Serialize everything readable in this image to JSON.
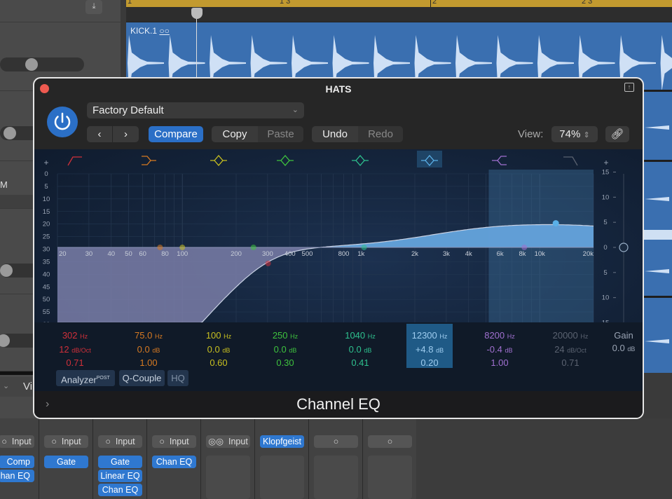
{
  "daw": {
    "ruler_labels": [
      "1",
      "1 3",
      "2",
      "2 3"
    ],
    "region_title": "KICK.1",
    "region_loop_icon": "loop-icon",
    "left_label": "M",
    "view_menu": "Vi",
    "mixer": {
      "strips": [
        {
          "input": "Input",
          "plugins": [
            "Comp",
            "han EQ"
          ]
        },
        {
          "input": "Input",
          "plugins": [
            "Gate"
          ]
        },
        {
          "input": "Input",
          "plugins": [
            "Gate",
            "Linear EQ",
            "Chan EQ"
          ]
        },
        {
          "input": "Input",
          "plugins": [
            "Chan EQ"
          ]
        },
        {
          "input": "Input",
          "plugins": [],
          "stereo": true
        },
        {
          "input": "Klopfgeist",
          "instrument": true,
          "plugins": []
        },
        {
          "input": "",
          "plugins": []
        },
        {
          "input": "",
          "plugins": []
        }
      ]
    }
  },
  "plugin": {
    "title": "HATS",
    "preset": "Factory Default",
    "buttons": {
      "compare": "Compare",
      "copy": "Copy",
      "paste": "Paste",
      "undo": "Undo",
      "redo": "Redo"
    },
    "view_label": "View:",
    "view_value": "74%",
    "footer_title": "Channel EQ",
    "accent": "#2b6fc6",
    "analyzer_label": "Analyzer",
    "analyzer_sup": "POST",
    "qcouple_label": "Q-Couple",
    "hq_label": "HQ",
    "gain_label": "Gain",
    "gain_value": "0.0",
    "gain_unit": "dB",
    "bands": [
      {
        "type": "low-cut",
        "freq": "302",
        "funit": "Hz",
        "gain": "12",
        "gunit": "dB/Oct",
        "q": "0.71",
        "color": "#d0303a"
      },
      {
        "type": "low-shelf",
        "freq": "75.0",
        "funit": "Hz",
        "gain": "0.0",
        "gunit": "dB",
        "q": "1.00",
        "color": "#d77a22"
      },
      {
        "type": "bell",
        "freq": "100",
        "funit": "Hz",
        "gain": "0.0",
        "gunit": "dB",
        "q": "0.60",
        "color": "#c8c020"
      },
      {
        "type": "bell",
        "freq": "250",
        "funit": "Hz",
        "gain": "0.0",
        "gunit": "dB",
        "q": "0.30",
        "color": "#3ec23e"
      },
      {
        "type": "bell",
        "freq": "1040",
        "funit": "Hz",
        "gain": "0.0",
        "gunit": "dB",
        "q": "0.41",
        "color": "#2ec08e"
      },
      {
        "type": "bell",
        "freq": "12300",
        "funit": "Hz",
        "gain": "+4.8",
        "gunit": "dB",
        "q": "0.20",
        "color": "#5ab0e8",
        "selected": true
      },
      {
        "type": "high-shelf",
        "freq": "8200",
        "funit": "Hz",
        "gain": "-0.4",
        "gunit": "dB",
        "q": "1.00",
        "color": "#a070d0"
      },
      {
        "type": "high-cut",
        "freq": "20000",
        "funit": "Hz",
        "gain": "24",
        "gunit": "dB/Oct",
        "q": "0.71",
        "color": "#5a6270",
        "off": true
      }
    ],
    "freq_ticks": [
      "20",
      "30",
      "40",
      "50",
      "60",
      "80",
      "100",
      "200",
      "300",
      "400",
      "500",
      "800",
      "1k",
      "2k",
      "3k",
      "4k",
      "6k",
      "8k",
      "10k",
      "20k"
    ],
    "freq_tick_values": [
      20,
      30,
      40,
      50,
      60,
      80,
      100,
      200,
      300,
      400,
      500,
      800,
      1000,
      2000,
      3000,
      4000,
      6000,
      8000,
      10000,
      20000
    ],
    "analyzer_scale": [
      "0",
      "5",
      "10",
      "15",
      "20",
      "25",
      "30",
      "35",
      "40",
      "45",
      "50",
      "55",
      "60"
    ],
    "gain_scale": [
      "15",
      "10",
      "5",
      "0",
      "5",
      "10",
      "15"
    ],
    "gain_scale_values": [
      15,
      10,
      5,
      0,
      -5,
      -10,
      -15
    ]
  }
}
